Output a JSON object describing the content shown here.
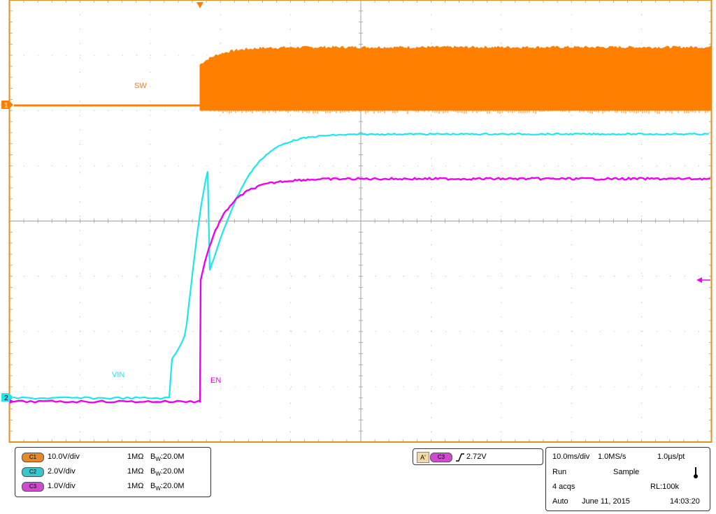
{
  "screen": {
    "trace_labels": {
      "sw": "SW",
      "vin": "VIN",
      "en": "EN"
    },
    "markers": {
      "ch1": "1",
      "ch2": "2"
    },
    "colors": {
      "ch1": "#ff8000",
      "ch2": "#1ee6f0",
      "ch3": "#ee00ee",
      "frame": "#e0901c",
      "grid": "#a0a0a0"
    }
  },
  "channels": [
    {
      "tag": "C1",
      "scale": "10.0V/div",
      "coupling": "1MΩ",
      "bw_prefix": "B",
      "bw_sub": "W",
      "bw_value": ":20.0M",
      "color": "#ff8000"
    },
    {
      "tag": "C2",
      "scale": "2.0V/div",
      "coupling": "1MΩ",
      "bw_prefix": "B",
      "bw_sub": "W",
      "bw_value": ":20.0M",
      "color": "#1ee6f0"
    },
    {
      "tag": "C3",
      "scale": "1.0V/div",
      "coupling": "1MΩ",
      "bw_prefix": "B",
      "bw_sub": "W",
      "bw_value": ":20.0M",
      "color": "#ee00ee"
    }
  ],
  "trigger": {
    "mode_tag": "A'",
    "source": "C3",
    "slope_icon": "rising-edge",
    "level": "2.72V"
  },
  "acquisition": {
    "timebase": "10.0ms/div",
    "sample_rate": "1.0MS/s",
    "resolution": "1.0µs/pt",
    "state": "Run",
    "mode": "Sample",
    "acqs": "4 acqs",
    "record_length": "RL:100k",
    "trigger_mode": "Auto",
    "date": "June 11, 2015",
    "time": "14:03:20"
  }
}
